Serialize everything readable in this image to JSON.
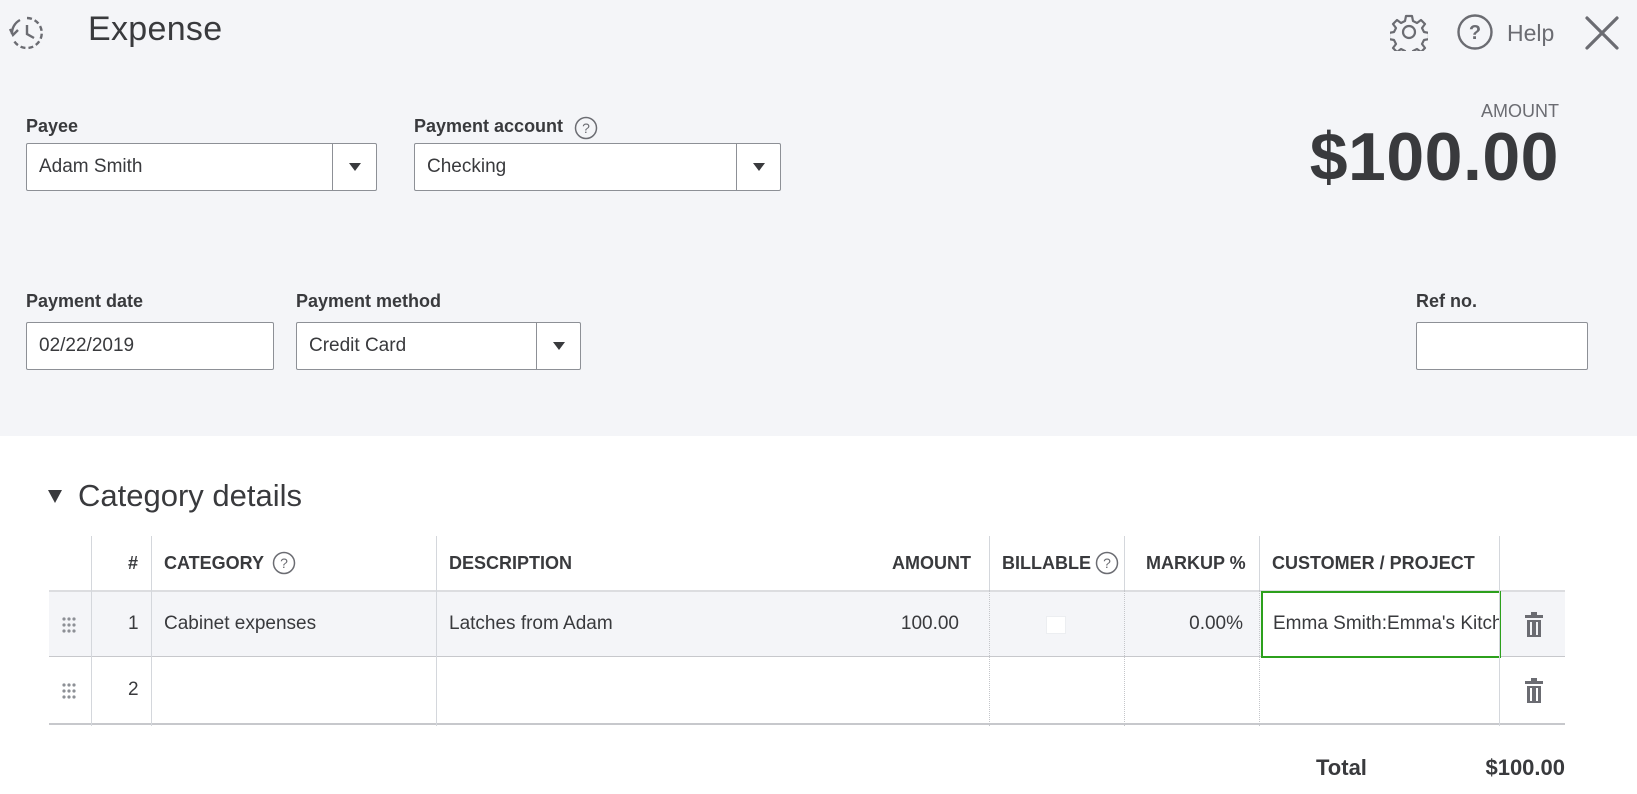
{
  "header": {
    "title": "Expense",
    "help_label": "Help"
  },
  "form": {
    "payee_label": "Payee",
    "payee_value": "Adam Smith",
    "payment_account_label": "Payment account",
    "payment_account_value": "Checking",
    "payment_date_label": "Payment date",
    "payment_date_value": "02/22/2019",
    "payment_method_label": "Payment method",
    "payment_method_value": "Credit Card",
    "ref_label": "Ref no.",
    "ref_value": "",
    "amount_label": "AMOUNT",
    "amount_value": "$100.00"
  },
  "category_details": {
    "title": "Category details",
    "columns": {
      "num": "#",
      "category": "CATEGORY",
      "description": "DESCRIPTION",
      "amount": "AMOUNT",
      "billable": "BILLABLE",
      "markup": "MARKUP %",
      "customer": "CUSTOMER / PROJECT"
    },
    "rows": [
      {
        "num": "1",
        "category": "Cabinet expenses",
        "description": "Latches from Adam",
        "amount": "100.00",
        "billable": false,
        "markup": "0.00%",
        "customer": "Emma Smith:Emma's Kitchen"
      },
      {
        "num": "2",
        "category": "",
        "description": "",
        "amount": "",
        "billable": false,
        "markup": "",
        "customer": ""
      }
    ],
    "total_label": "Total",
    "total_value": "$100.00"
  },
  "colors": {
    "focus_border": "#2ca01c",
    "panel_bg": "#f4f5f8"
  }
}
